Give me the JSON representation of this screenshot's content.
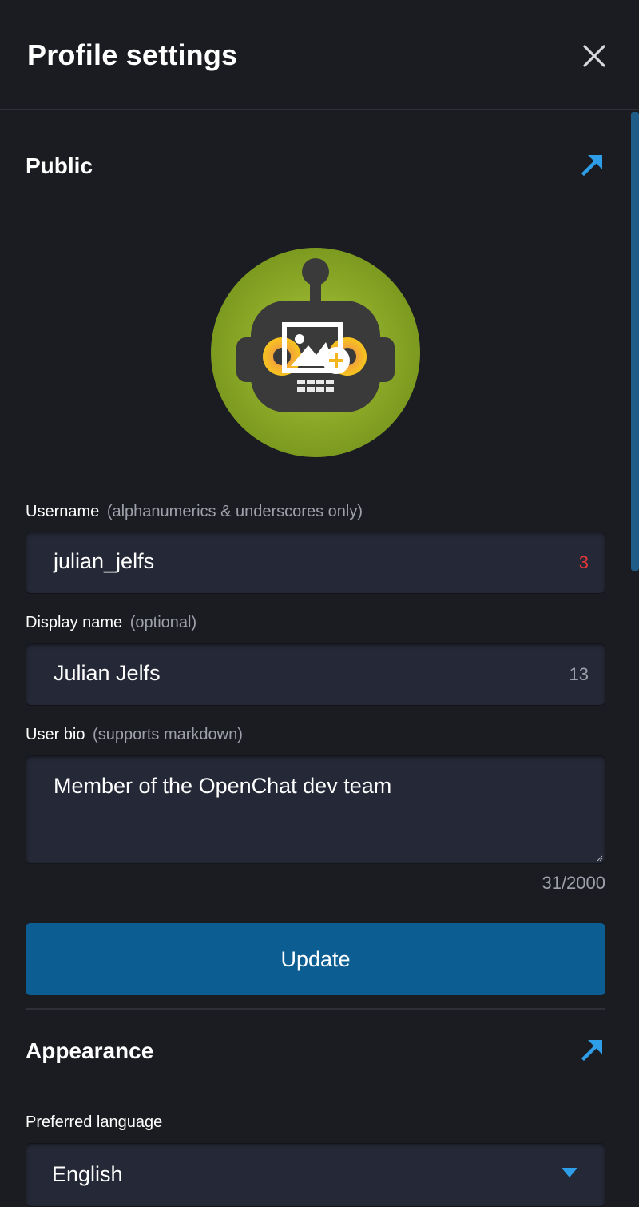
{
  "header": {
    "title": "Profile settings"
  },
  "public": {
    "title": "Public",
    "username": {
      "label": "Username",
      "hint": "(alphanumerics & underscores only)",
      "value": "julian_jelfs",
      "counter": "3",
      "counter_color": "#e5383b"
    },
    "display_name": {
      "label": "Display name",
      "hint": "(optional)",
      "value": "Julian Jelfs",
      "counter": "13"
    },
    "bio": {
      "label": "User bio",
      "hint": "(supports markdown)",
      "value": "Member of the OpenChat dev team",
      "counter": "31/2000"
    },
    "update_label": "Update"
  },
  "appearance": {
    "title": "Appearance",
    "language": {
      "label": "Preferred language",
      "value": "English"
    }
  },
  "icons": {
    "close": "close-icon",
    "external": "arrow-up-right-icon",
    "avatar": "robot-avatar",
    "add_image": "add-image-icon",
    "dropdown": "caret-down-icon"
  },
  "colors": {
    "accent": "#2f9ee8",
    "avatar_bg": "#8fad27",
    "button": "#0c5e92"
  }
}
